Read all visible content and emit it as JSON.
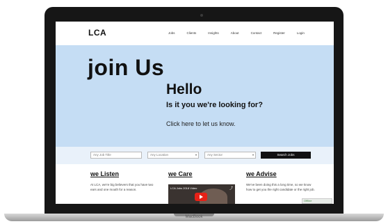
{
  "device": {
    "label": "MacBook"
  },
  "nav": {
    "logo": "LCA",
    "links": [
      "Jobs",
      "Clients",
      "Insights",
      "About",
      "Contact",
      "Register",
      "Login"
    ]
  },
  "hero": {
    "title": "join Us",
    "heading": "Hello",
    "subheading": "Is it you we're looking for?",
    "cta": "Click here to let us know."
  },
  "search": {
    "job_title_placeholder": "Any Job Title",
    "location": "Any Location",
    "sector": "Any Sector",
    "button": "Search Jobs"
  },
  "columns": {
    "listen": {
      "title": "we Listen",
      "text": "At LCA, we're big believers that you have two ears and one mouth for a reason."
    },
    "care": {
      "title": "we Care",
      "video_title": "LCA Jobs 2018 Video"
    },
    "advise": {
      "title": "we Advise",
      "text": "We've been doing this a long time, so we know how to get you the right candidate or the right job."
    }
  },
  "chat": {
    "label": "Offline"
  },
  "colors": {
    "hero_bg": "#c5ddf4",
    "search_bg": "#e9f1fa",
    "button": "#111111"
  }
}
